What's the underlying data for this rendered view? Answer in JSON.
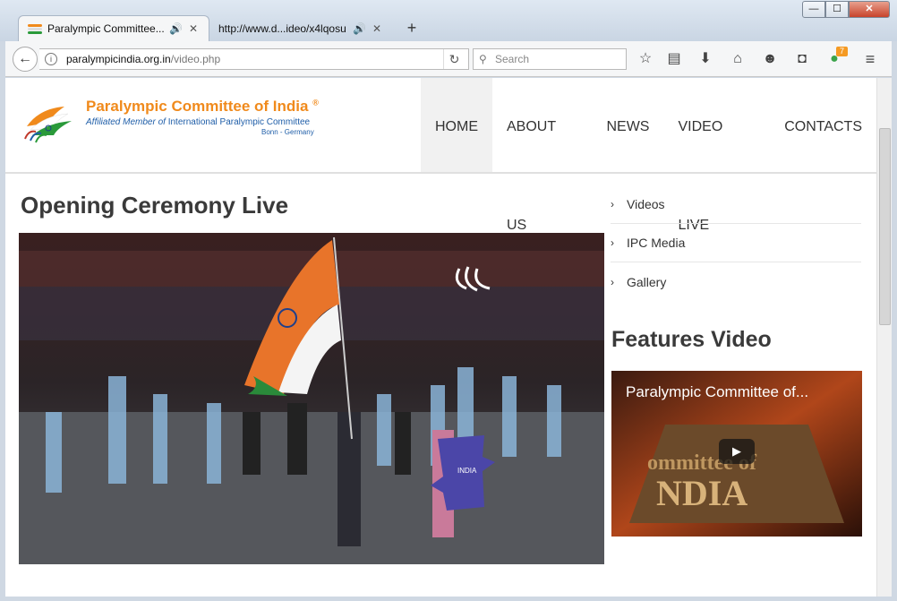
{
  "browser": {
    "tabs": [
      {
        "title": "Paralympic Committee...",
        "speaker": "🔊",
        "close": "✕"
      },
      {
        "title": "http://www.d...ideo/x4lqosu",
        "speaker": "🔊",
        "close": "✕"
      }
    ],
    "new_tab": "+",
    "window_buttons": {
      "minimize": "—",
      "maximize": "☐",
      "close": "✕"
    },
    "url_host": "paralympicindia.org.in",
    "url_path": "/video.php",
    "search_placeholder": "Search",
    "notification_count": "7",
    "icons": [
      "back-arrow-icon",
      "info-icon",
      "reload-icon",
      "search-icon",
      "bookmark-star-icon",
      "reading-list-icon",
      "download-icon",
      "home-icon",
      "chat-icon",
      "pocket-icon",
      "extension-icon",
      "hamburger-menu-icon"
    ]
  },
  "site": {
    "logo": {
      "name": "Paralympic Committee of India",
      "reg": "®",
      "affiliation_prefix": "Affiliated Member of",
      "affiliation_org": "International Paralympic Committee",
      "location": "Bonn - Germany"
    },
    "menu": [
      "HOME",
      "ABOUT US",
      "NEWS",
      "VIDEO LIVE",
      "CONTACTS"
    ],
    "page_title": "Opening Ceremony Live",
    "sidebar_links": [
      "Videos",
      "IPC Media",
      "Gallery"
    ],
    "features_title": "Features Video",
    "feature_video_title": "Paralympic Committee of...",
    "feature_video_text": "Paralympic Committee of INDIA",
    "flag_card_text": "INDIA"
  },
  "colors": {
    "logo_orange": "#f08a1c",
    "logo_blue": "#1f5ea8",
    "heading": "#3a3a3a"
  }
}
